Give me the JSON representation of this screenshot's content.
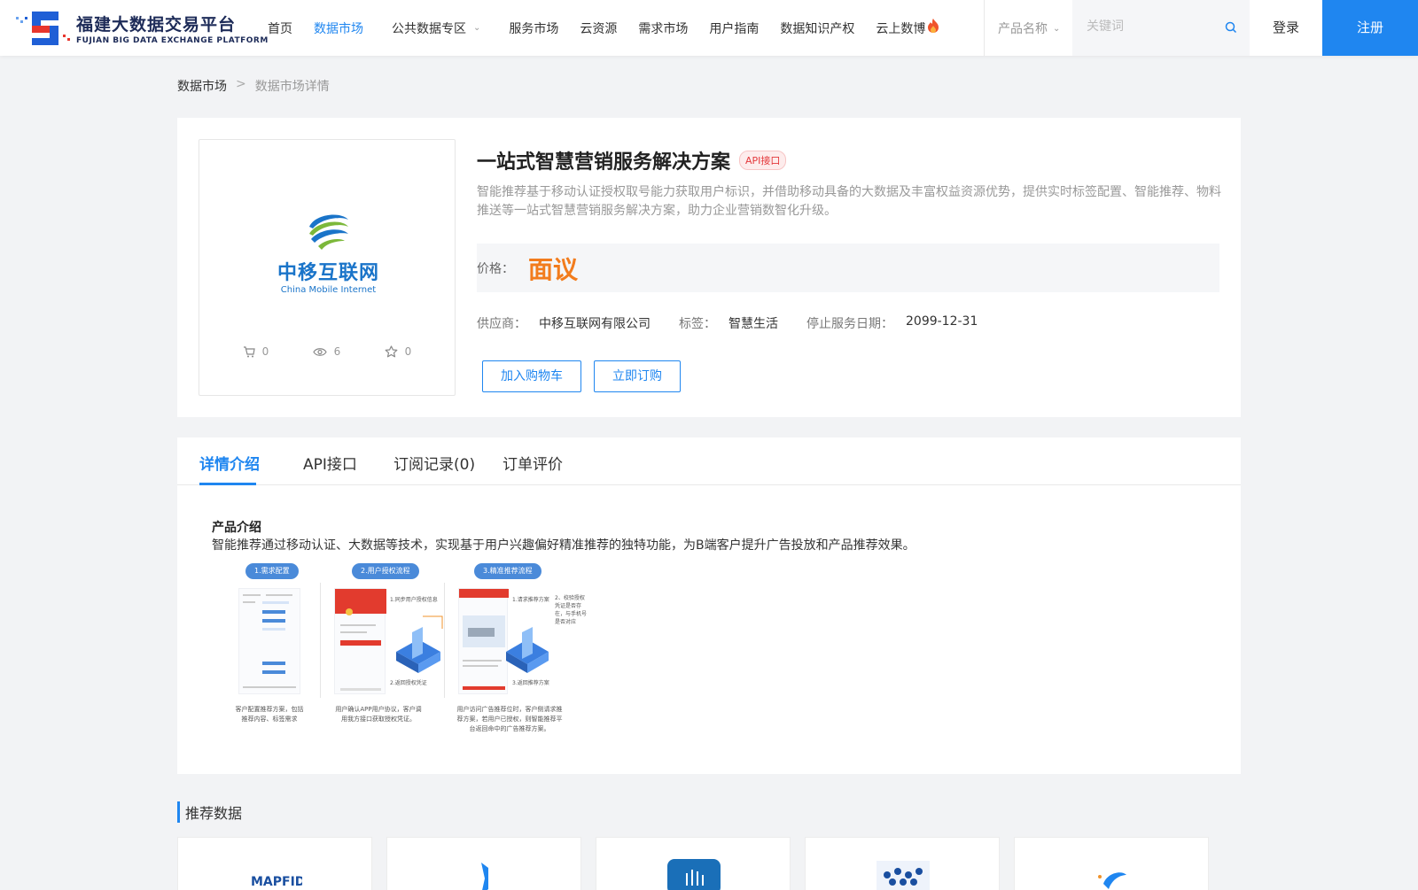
{
  "site": {
    "name_cn": "福建大数据交易平台",
    "name_en": "FUJIAN BIG DATA EXCHANGE  PLATFORM"
  },
  "nav": {
    "items": [
      {
        "label": "首页"
      },
      {
        "label": "数据市场"
      },
      {
        "label": "公共数据专区"
      },
      {
        "label": "服务市场"
      },
      {
        "label": "云资源"
      },
      {
        "label": "需求市场"
      },
      {
        "label": "用户指南"
      },
      {
        "label": "数据知识产权"
      },
      {
        "label": "云上数博"
      }
    ]
  },
  "search": {
    "category": "产品名称",
    "placeholder": "关键词"
  },
  "auth": {
    "login": "登录",
    "register": "注册"
  },
  "breadcrumb": {
    "root": "数据市场",
    "separator": ">",
    "current": "数据市场详情"
  },
  "product": {
    "logo_cn": "中移互联网",
    "logo_en": "China Mobile Internet",
    "title": "一站式智慧营销服务解决方案",
    "tag": "API接口",
    "description": "智能推荐基于移动认证授权取号能力获取用户标识，并借助移动具备的大数据及丰富权益资源优势，提供实时标签配置、智能推荐、物料推送等一站式智慧营销服务解决方案，助力企业营销数智化升级。",
    "price_label": "价格：",
    "price_value": "面议",
    "supplier_label": "供应商：",
    "supplier": "中移互联网有限公司",
    "tag_label": "标签：",
    "tag_value": "智慧生活",
    "end_date_label": "停止服务日期：",
    "end_date": "2099-12-31",
    "stats": {
      "cart": "0",
      "views": "6",
      "favorites": "0"
    },
    "add_cart": "加入购物车",
    "subscribe": "立即订购"
  },
  "tabs": [
    {
      "label": "详情介绍"
    },
    {
      "label": "API接口"
    },
    {
      "label": "订阅记录(0)"
    },
    {
      "label": "订单评价"
    }
  ],
  "detail": {
    "intro_title": "产品介绍",
    "intro_text": "智能推荐通过移动认证、大数据等技术，实现基于用户兴趣偏好精准推荐的独特功能，为B端客户提升广告投放和产品推荐效果。",
    "diagram": {
      "steps": [
        "1.需求配置",
        "2.用户授权流程",
        "3.精准推荐流程"
      ],
      "captions": [
        "客户配置推荐方案，包括推荐内容、标签需求",
        "用户确认APP用户协议，客户调用我方接口获取授权凭证。",
        "用户访问广告推荐位时，客户侧请求推荐方案，若用户已授权，则智能推荐平台返回命中的广告推荐方案。"
      ],
      "notes": [
        "1.同步用户授权信息",
        "2.返回授权凭证",
        "1.请求推荐方案",
        "2、校验授权凭证是否存在，与手机号是否对应",
        "3.返回推荐方案"
      ]
    }
  },
  "recommend": {
    "title": "推荐数据"
  }
}
